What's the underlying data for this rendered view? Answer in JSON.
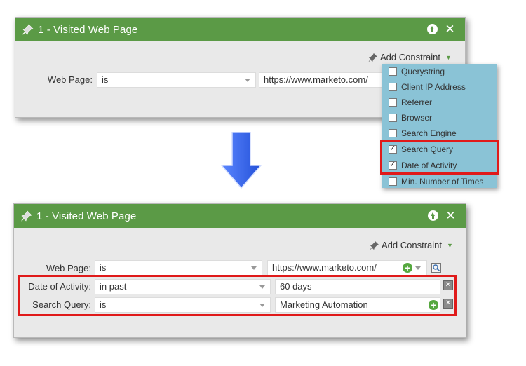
{
  "top_panel": {
    "title": "1 - Visited Web Page",
    "add_constraint": "Add Constraint",
    "rows": [
      {
        "label": "Web Page:",
        "operator": "is",
        "value": "https://www.marketo.com/"
      }
    ]
  },
  "dropdown": {
    "items": [
      {
        "label": "Querystring",
        "checked": false
      },
      {
        "label": "Client IP Address",
        "checked": false
      },
      {
        "label": "Referrer",
        "checked": false
      },
      {
        "label": "Browser",
        "checked": false
      },
      {
        "label": "Search Engine",
        "checked": false
      },
      {
        "label": "Search Query",
        "checked": true
      },
      {
        "label": "Date of Activity",
        "checked": true
      },
      {
        "label": "Min. Number of Times",
        "checked": false
      }
    ]
  },
  "bottom_panel": {
    "title": "1 - Visited Web Page",
    "add_constraint": "Add Constraint",
    "rows": [
      {
        "label": "Web Page:",
        "operator": "is",
        "value": "https://www.marketo.com/"
      },
      {
        "label": "Date of Activity:",
        "operator": "in past",
        "value": "60 days"
      },
      {
        "label": "Search Query:",
        "operator": "is",
        "value": "Marketing Automation"
      }
    ]
  },
  "colors": {
    "header_green": "#5b9a46",
    "panel_bg": "#e9e9e9",
    "dropdown_bg": "#8ac3d6",
    "highlight_red": "#e01a1a",
    "arrow_blue": "#3b6ff0"
  },
  "icons": [
    "pin-icon",
    "move-up-icon",
    "close-icon",
    "add-icon",
    "delete-icon",
    "lookup-icon",
    "down-arrow-icon"
  ]
}
